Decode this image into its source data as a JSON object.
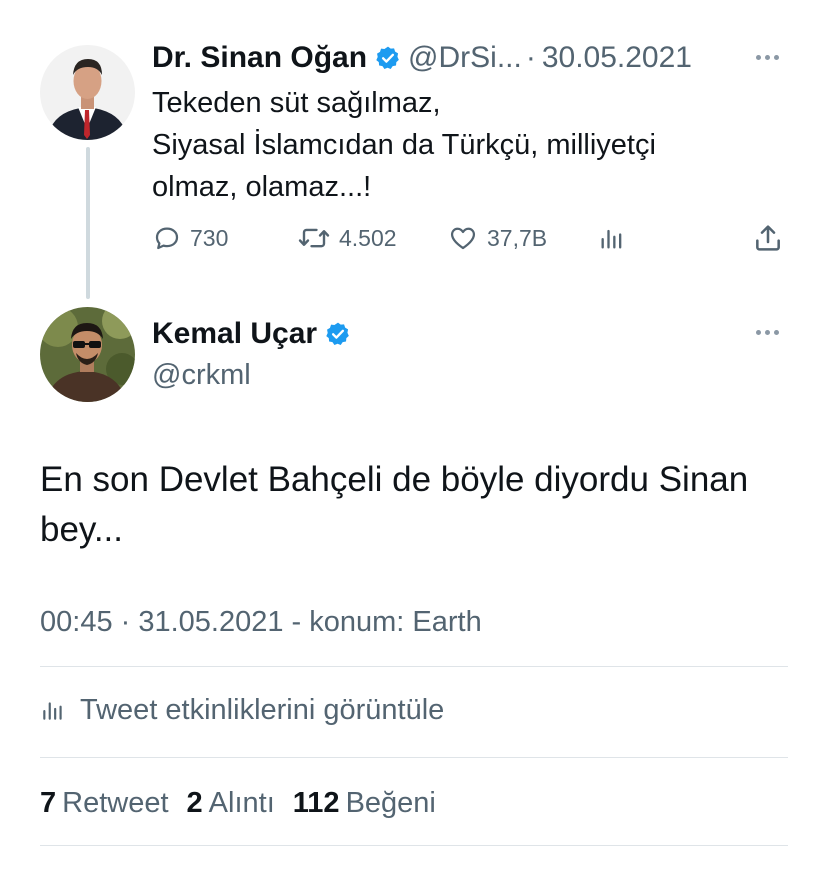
{
  "colors": {
    "verified": "#1d9bf0",
    "secondary_text": "#536471",
    "thread_line": "#cfd9de"
  },
  "parent_tweet": {
    "author_name": "Dr. Sinan Oğan",
    "handle": "@DrSi...",
    "separator": "·",
    "date": "30.05.2021",
    "text_lines": [
      "Tekeden süt sağılmaz,",
      "Siyasal İslamcıdan da Türkçü, milliyetçi",
      "olmaz, olamaz...!"
    ],
    "actions": {
      "reply_count": "730",
      "retweet_count": "4.502",
      "like_count": "37,7B"
    },
    "icons": [
      "reply-icon",
      "retweet-icon",
      "like-icon",
      "views-icon",
      "share-icon",
      "more-icon"
    ]
  },
  "main_tweet": {
    "author_name": "Kemal Uçar",
    "handle": "@crkml",
    "text_lines": [
      "En son Devlet Bahçeli de böyle diyordu Sinan",
      "bey..."
    ],
    "meta": "00:45 · 31.05.2021 - konum: Earth",
    "activity_label": "Tweet etkinliklerini görüntüle",
    "stats": {
      "retweet_count": "7",
      "retweet_label": "Retweet",
      "quote_count": "2",
      "quote_label": "Alıntı",
      "like_count": "112",
      "like_label": "Beğeni"
    }
  }
}
